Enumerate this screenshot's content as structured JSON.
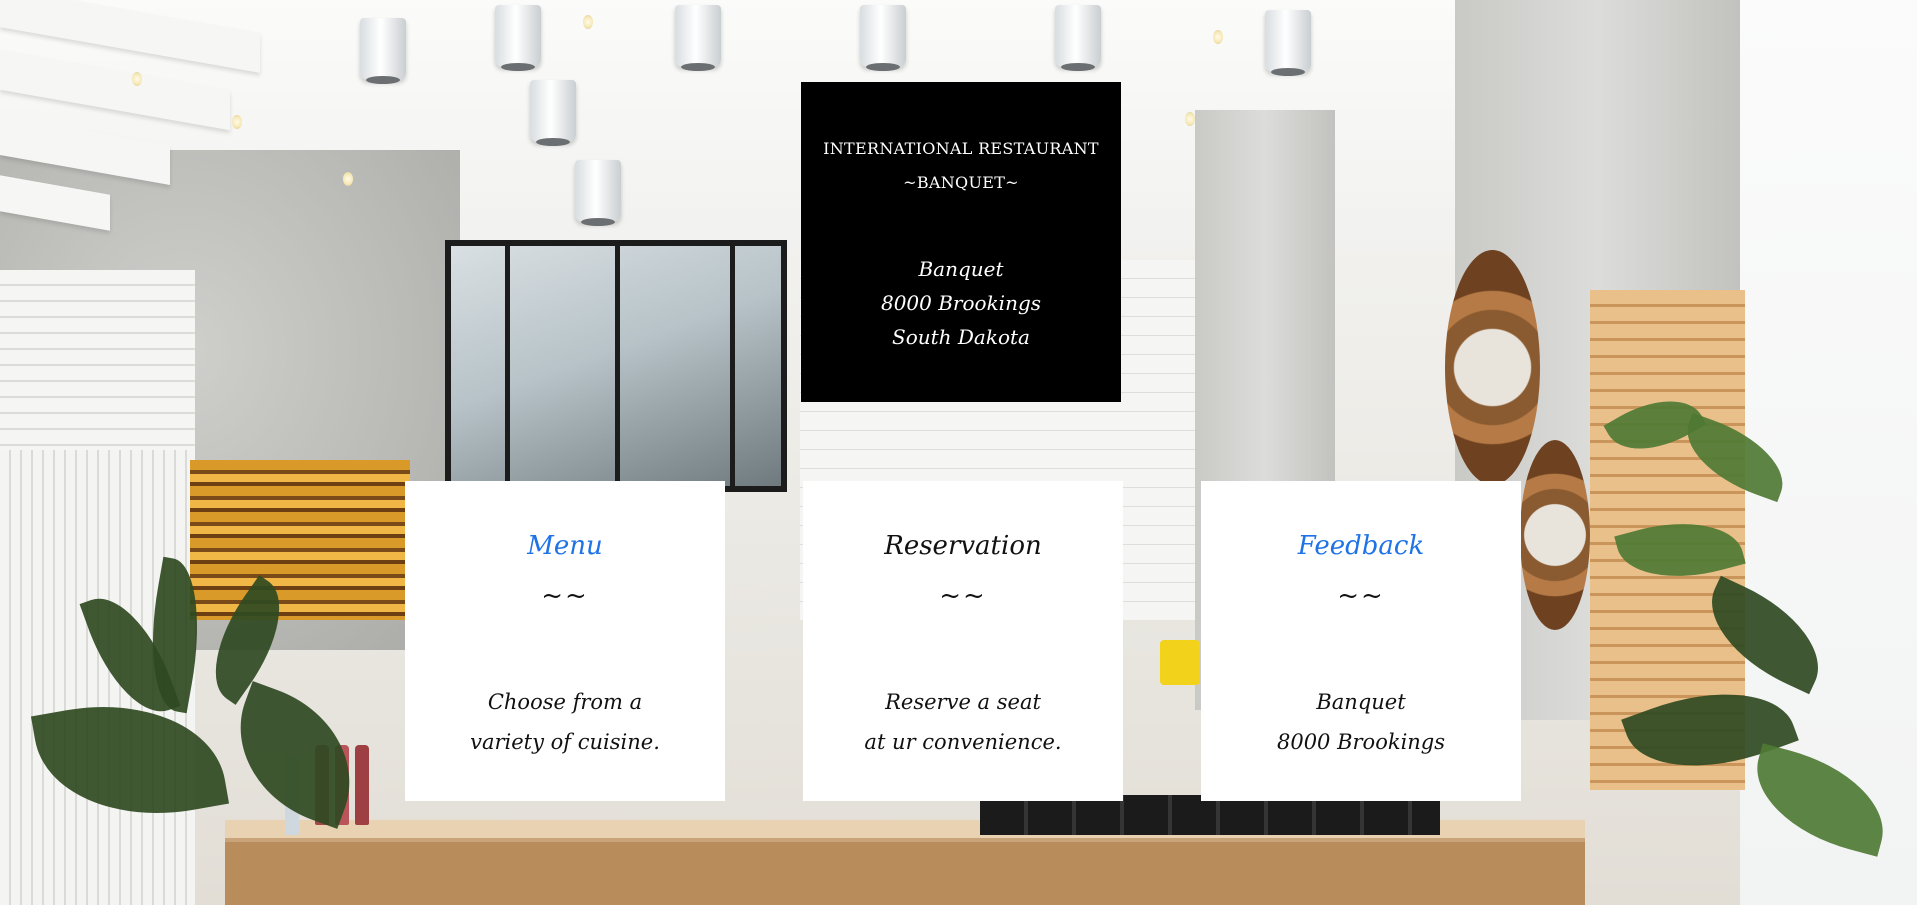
{
  "header": {
    "title_line1": "INTERNATIONAL RESTAURANT",
    "title_line2": "~BANQUET~",
    "address_line1": "Banquet",
    "address_line2": "8000 Brookings",
    "address_line3": "South Dakota"
  },
  "cards": [
    {
      "title": "Menu",
      "divider": "~~",
      "text_line1": "Choose from a",
      "text_line2": "variety of cuisine."
    },
    {
      "title": "Reservation",
      "divider": "~~",
      "text_line1": "Reserve a seat",
      "text_line2": "at ur convenience."
    },
    {
      "title": "Feedback",
      "divider": "~~",
      "text_line1": "Banquet",
      "text_line2": "8000 Brookings"
    }
  ],
  "colors": {
    "link": "#1f73e6",
    "panel_bg": "#000000",
    "card_bg": "#ffffff"
  },
  "background_image": "restaurant-interior-photo"
}
